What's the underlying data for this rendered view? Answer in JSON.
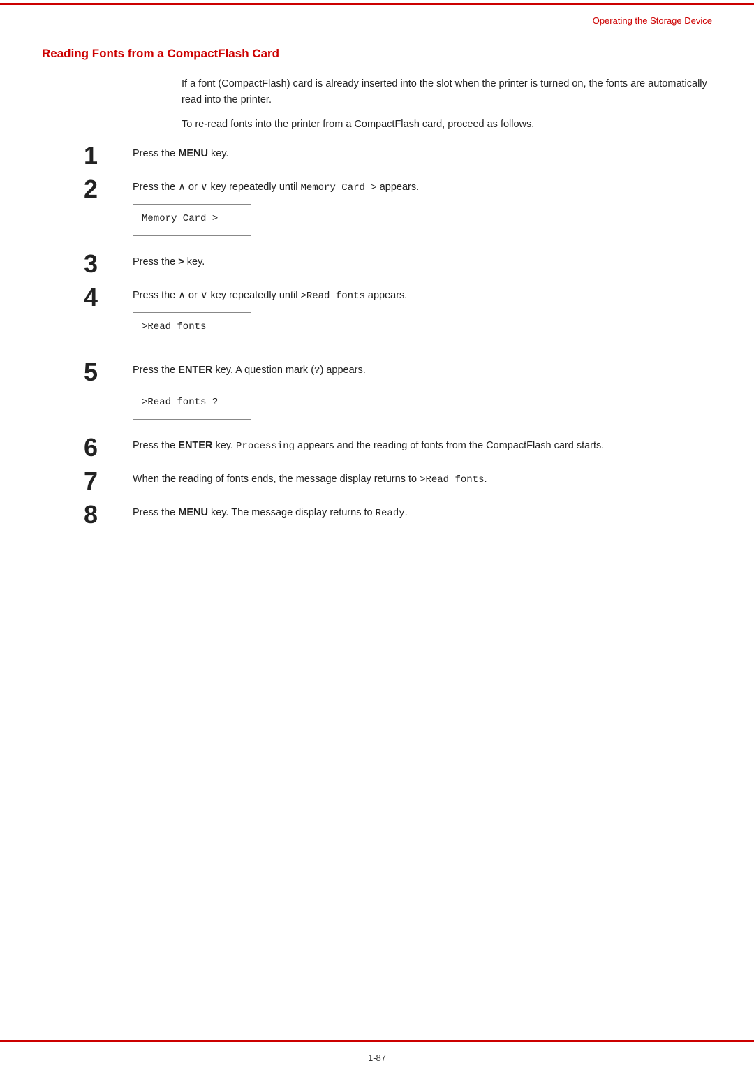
{
  "header": {
    "section_label": "Operating the Storage Device"
  },
  "section": {
    "title": "Reading Fonts from a CompactFlash Card"
  },
  "intro": {
    "para1": "If a font (CompactFlash) card is already inserted into the slot when the printer is turned on, the fonts are automatically read into the printer.",
    "para2": "To re-read fonts into the printer from a CompactFlash card, proceed as follows."
  },
  "steps": [
    {
      "number": "1",
      "text_before": "Press the ",
      "bold": "MENU",
      "text_after": " key.",
      "has_code_box": false
    },
    {
      "number": "2",
      "text_before": "Press the ∧ or ∨ key repeatedly until ",
      "mono": "Memory Card  >",
      "text_after": " appears.",
      "has_code_box": true,
      "code_content": "Memory Card   >"
    },
    {
      "number": "3",
      "text_before": "Press the ",
      "bold": ">",
      "text_after": " key.",
      "has_code_box": false
    },
    {
      "number": "4",
      "text_before": "Press the ∧ or ∨ key repeatedly until ",
      "mono": ">Read fonts",
      "text_after": " appears.",
      "has_code_box": true,
      "code_content": ">Read fonts"
    },
    {
      "number": "5",
      "text_before": "Press the ",
      "bold": "ENTER",
      "text_after": " key. A question mark (",
      "mono2": "?",
      "text_after2": ") appears.",
      "has_code_box": true,
      "code_content": ">Read fonts ?"
    },
    {
      "number": "6",
      "text_before": "Press the ",
      "bold": "ENTER",
      "text_middle": " key. ",
      "mono": "Processing",
      "text_after": " appears and the reading of fonts from the CompactFlash card starts.",
      "has_code_box": false
    },
    {
      "number": "7",
      "text_before": "When the reading of fonts ends, the message display returns to ",
      "mono": ">Read fonts",
      "text_after": ".",
      "has_code_box": false
    },
    {
      "number": "8",
      "text_before": "Press the ",
      "bold": "MENU",
      "text_middle": " key. The message display returns to ",
      "mono": "Ready",
      "text_after": ".",
      "has_code_box": false
    }
  ],
  "footer": {
    "page_number": "1-87"
  }
}
